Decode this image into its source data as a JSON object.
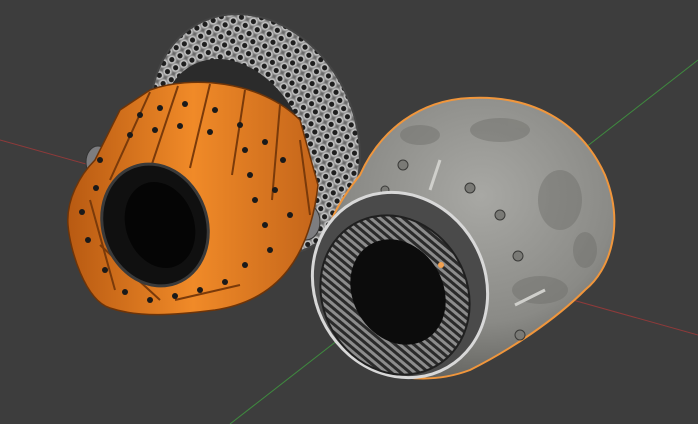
{
  "viewport": {
    "background_color": "#3d3d3d",
    "x_axis_color": "#9a3a3a",
    "y_axis_color": "#3f8a3f",
    "selection_outline_color": "#f0963c",
    "origin_dot_color": "#f0a050"
  },
  "objects": [
    {
      "kind": "jet-engine-nozzle-orange",
      "state": "unselected",
      "colors": {
        "petals": "#e3791a",
        "petal_shadow": "#9a4a10",
        "mesh_ring": "#b6b6b6",
        "holes": "#1f1f1f"
      }
    },
    {
      "kind": "jet-engine-nozzle-grey",
      "state": "active-selected",
      "colors": {
        "shell": "#9a9a96",
        "shell_dark": "#5c5c58",
        "ring": "#6c6c6c",
        "core": "#0f0f0f"
      }
    }
  ]
}
